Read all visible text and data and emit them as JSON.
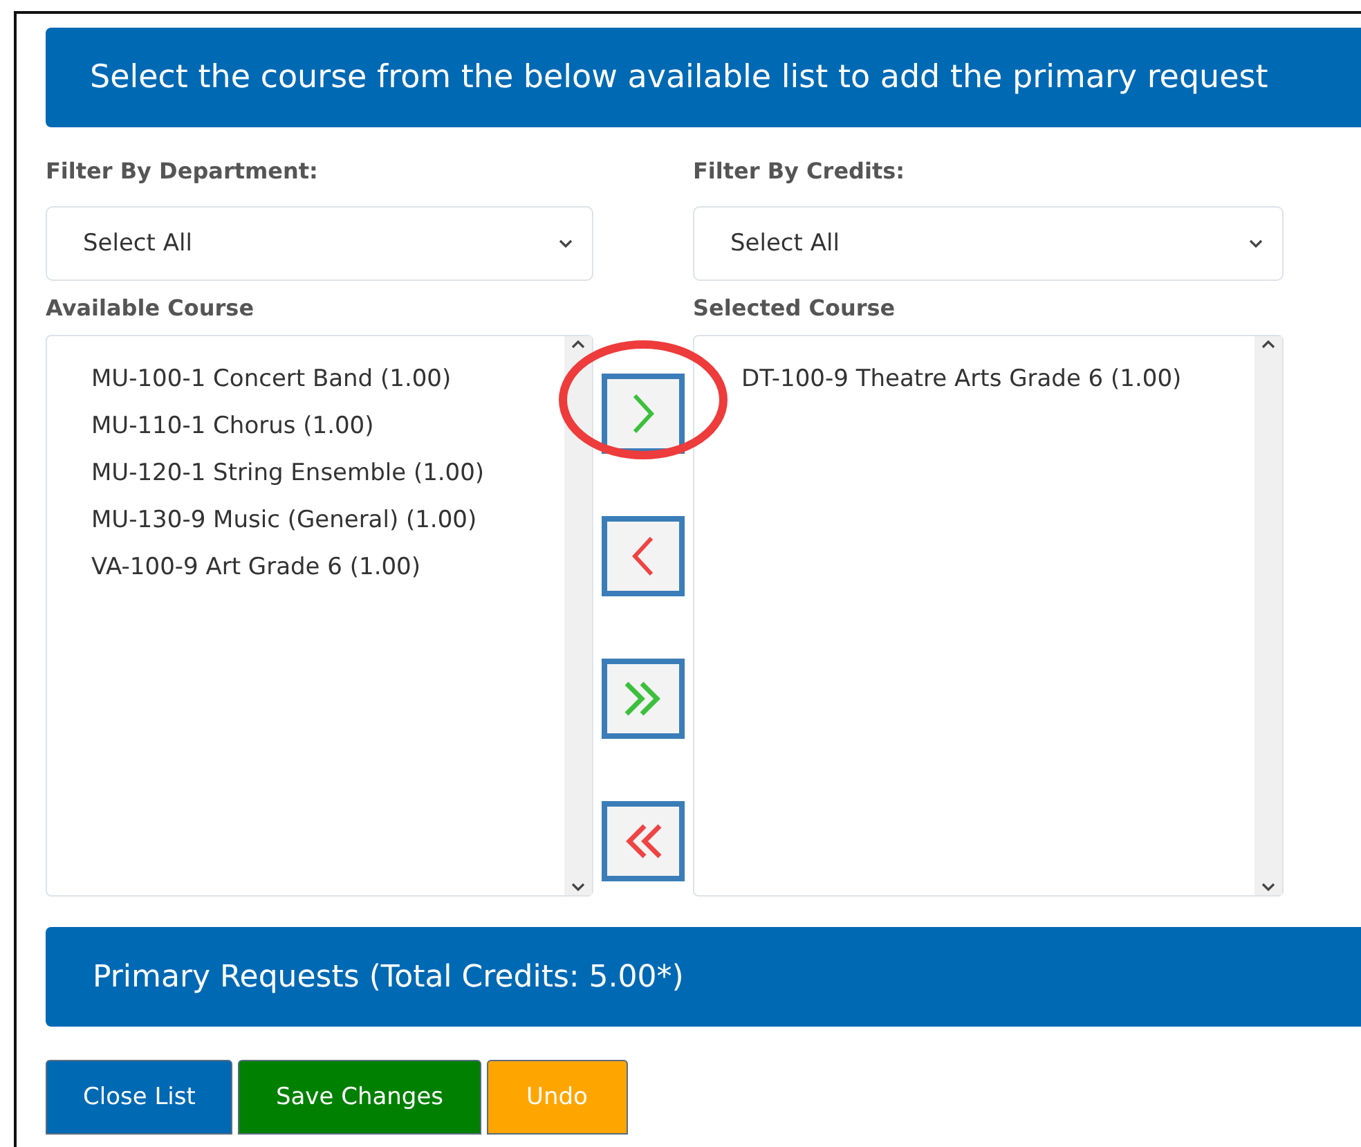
{
  "header": {
    "title": "Select the course from the below available list to add the primary request"
  },
  "filters": [
    {
      "label": "Filter By Department:",
      "value": "Select All"
    },
    {
      "label": "Filter By Credits:",
      "value": "Select All"
    }
  ],
  "available": {
    "label": "Available Course",
    "items": [
      "MU-100-1 Concert Band (1.00)",
      "MU-110-1 Chorus (1.00)",
      "MU-120-1 String Ensemble (1.00)",
      "MU-130-9 Music (General) (1.00)",
      "VA-100-9 Art Grade 6 (1.00)"
    ]
  },
  "move_buttons": [
    {
      "kind": "add",
      "highlighted": true
    },
    {
      "kind": "remove",
      "highlighted": false
    },
    {
      "kind": "add_all",
      "highlighted": false
    },
    {
      "kind": "remove_all",
      "highlighted": false
    }
  ],
  "selected": {
    "label": "Selected Course",
    "items": [
      "DT-100-9 Theatre Arts Grade 6 (1.00)"
    ]
  },
  "summary": {
    "title": "Primary Requests (Total Credits: 5.00*)"
  },
  "actions": [
    {
      "label": "Close List",
      "kind": "primary"
    },
    {
      "label": "Save Changes",
      "kind": "success"
    },
    {
      "label": "Undo",
      "kind": "warning"
    }
  ]
}
